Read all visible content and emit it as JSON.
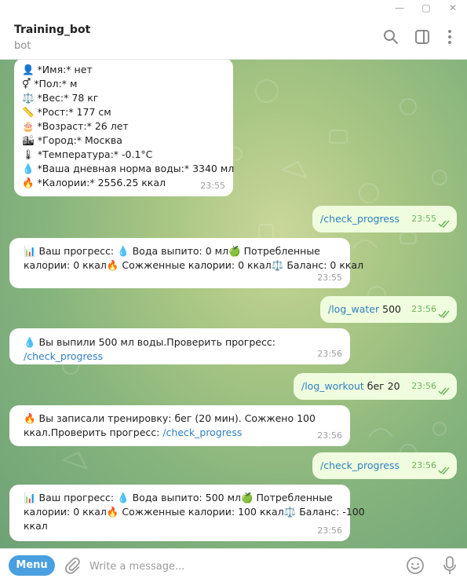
{
  "window": {
    "controls": {
      "minimize": "—",
      "maximize": "▢",
      "close": "✕"
    }
  },
  "header": {
    "title": "Training_bot",
    "subtitle": "bot",
    "icons": [
      "search-icon",
      "sidebar-toggle-icon",
      "more-vertical-icon"
    ]
  },
  "messages": [
    {
      "direction": "in",
      "lines": [
        "👤 *Имя:* нет",
        "⚥ *Пол:* м",
        "⚖️ *Вес:* 78 кг",
        "📏 *Рост:* 177 см",
        "🎂 *Возраст:* 26 лет",
        "🏙 *Город:* Москва",
        "🌡 *Температура:* -0.1°C",
        "💧 *Ваша дневная норма воды:* 3340 мл",
        "🔥 *Калории:* 2556.25 ккал"
      ],
      "time": "23:55"
    },
    {
      "direction": "out",
      "command": "/check_progress",
      "suffix": "",
      "time": "23:55"
    },
    {
      "direction": "in",
      "lines": [
        "📊 Ваш прогресс: 💧 Вода выпито: 0 мл🍏 Потребленные",
        "калории: 0 ккал🔥 Сожженные калории: 0 ккал⚖️ Баланс: 0 ккал"
      ],
      "time": "23:55"
    },
    {
      "direction": "out",
      "command": "/log_water",
      "suffix": " 500",
      "time": "23:56"
    },
    {
      "direction": "in",
      "text": "💧 Вы выпили 500 мл воды.Проверить прогресс: ",
      "link": "/check_progress",
      "time": "23:56"
    },
    {
      "direction": "out",
      "command": "/log_workout",
      "suffix": " бег 20",
      "time": "23:56"
    },
    {
      "direction": "in",
      "line1": "🔥 Вы записали тренировку: бег (20 мин). Сожжено 100",
      "line2_text": "ккал.Проверить прогресс: ",
      "link": "/check_progress",
      "time": "23:56"
    },
    {
      "direction": "out",
      "command": "/check_progress",
      "suffix": "",
      "time": "23:56"
    },
    {
      "direction": "in",
      "lines": [
        "📊 Ваш прогресс: 💧 Вода выпито: 500 мл🍏 Потребленные",
        "калории: 0 ккал🔥 Сожженные калории: 100 ккал⚖️ Баланс: -100",
        "ккал"
      ],
      "time": "23:56"
    }
  ],
  "composer": {
    "menu_label": "Menu",
    "placeholder": "Write a message...",
    "value": ""
  },
  "colors": {
    "accent": "#4a9fe0",
    "outgoing_bubble": "#effdde",
    "incoming_bubble": "#ffffff",
    "link": "#2f7fc0",
    "read_check": "#6fb35f"
  }
}
